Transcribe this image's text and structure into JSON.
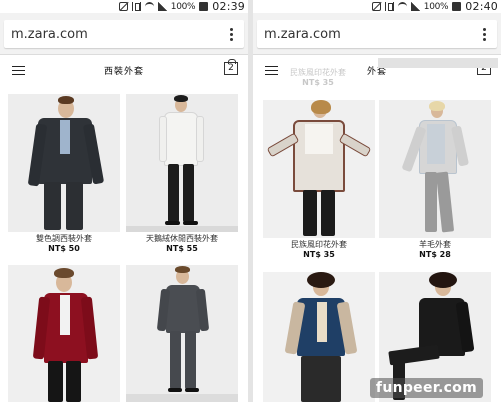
{
  "left": {
    "status": {
      "battery_pct": "100%",
      "time": "02:39"
    },
    "browser": {
      "url": "m.zara.com"
    },
    "header": {
      "title": "西裝外套",
      "cart_count": "2"
    },
    "products": [
      {
        "caption": "雙色調西裝外套",
        "price": "NT$ 50"
      },
      {
        "caption": "天鵝絨休閒西裝外套",
        "price": "NT$ 55"
      },
      {
        "caption": "",
        "price": ""
      },
      {
        "caption": "",
        "price": ""
      }
    ]
  },
  "right": {
    "status": {
      "battery_pct": "100%",
      "time": "02:40"
    },
    "browser": {
      "url": "m.zara.com"
    },
    "header": {
      "title": "外套",
      "cart_count": "2"
    },
    "ghost": {
      "caption": "民族風印花外套",
      "price": "NT$ 35"
    },
    "products": [
      {
        "caption": "民族風印花外套",
        "price": "NT$ 35"
      },
      {
        "caption": "羊毛外套",
        "price": "NT$ 28"
      },
      {
        "caption": "",
        "price": ""
      },
      {
        "caption": "",
        "price": ""
      }
    ]
  },
  "watermark": "funpeer.com",
  "colors": {
    "background": "#ffffff",
    "url_bar": "#f2f2f2",
    "text": "#333333"
  }
}
